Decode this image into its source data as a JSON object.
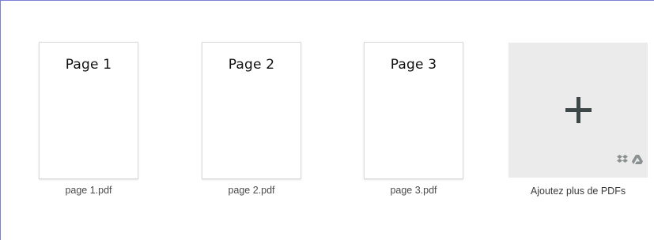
{
  "files": [
    {
      "thumb_title": "Page 1",
      "name": "page 1.pdf"
    },
    {
      "thumb_title": "Page 2",
      "name": "page 2.pdf"
    },
    {
      "thumb_title": "Page 3",
      "name": "page 3.pdf"
    }
  ],
  "add_more": {
    "label": "Ajoutez plus de PDFs",
    "icon": "plus-icon",
    "sources": [
      "dropbox-icon",
      "google-drive-icon"
    ]
  },
  "colors": {
    "frame_border": "#7b7fd6",
    "add_box_bg": "#ebebeb",
    "plus": "#3e4747",
    "source_icons": "#8a8f8f"
  }
}
